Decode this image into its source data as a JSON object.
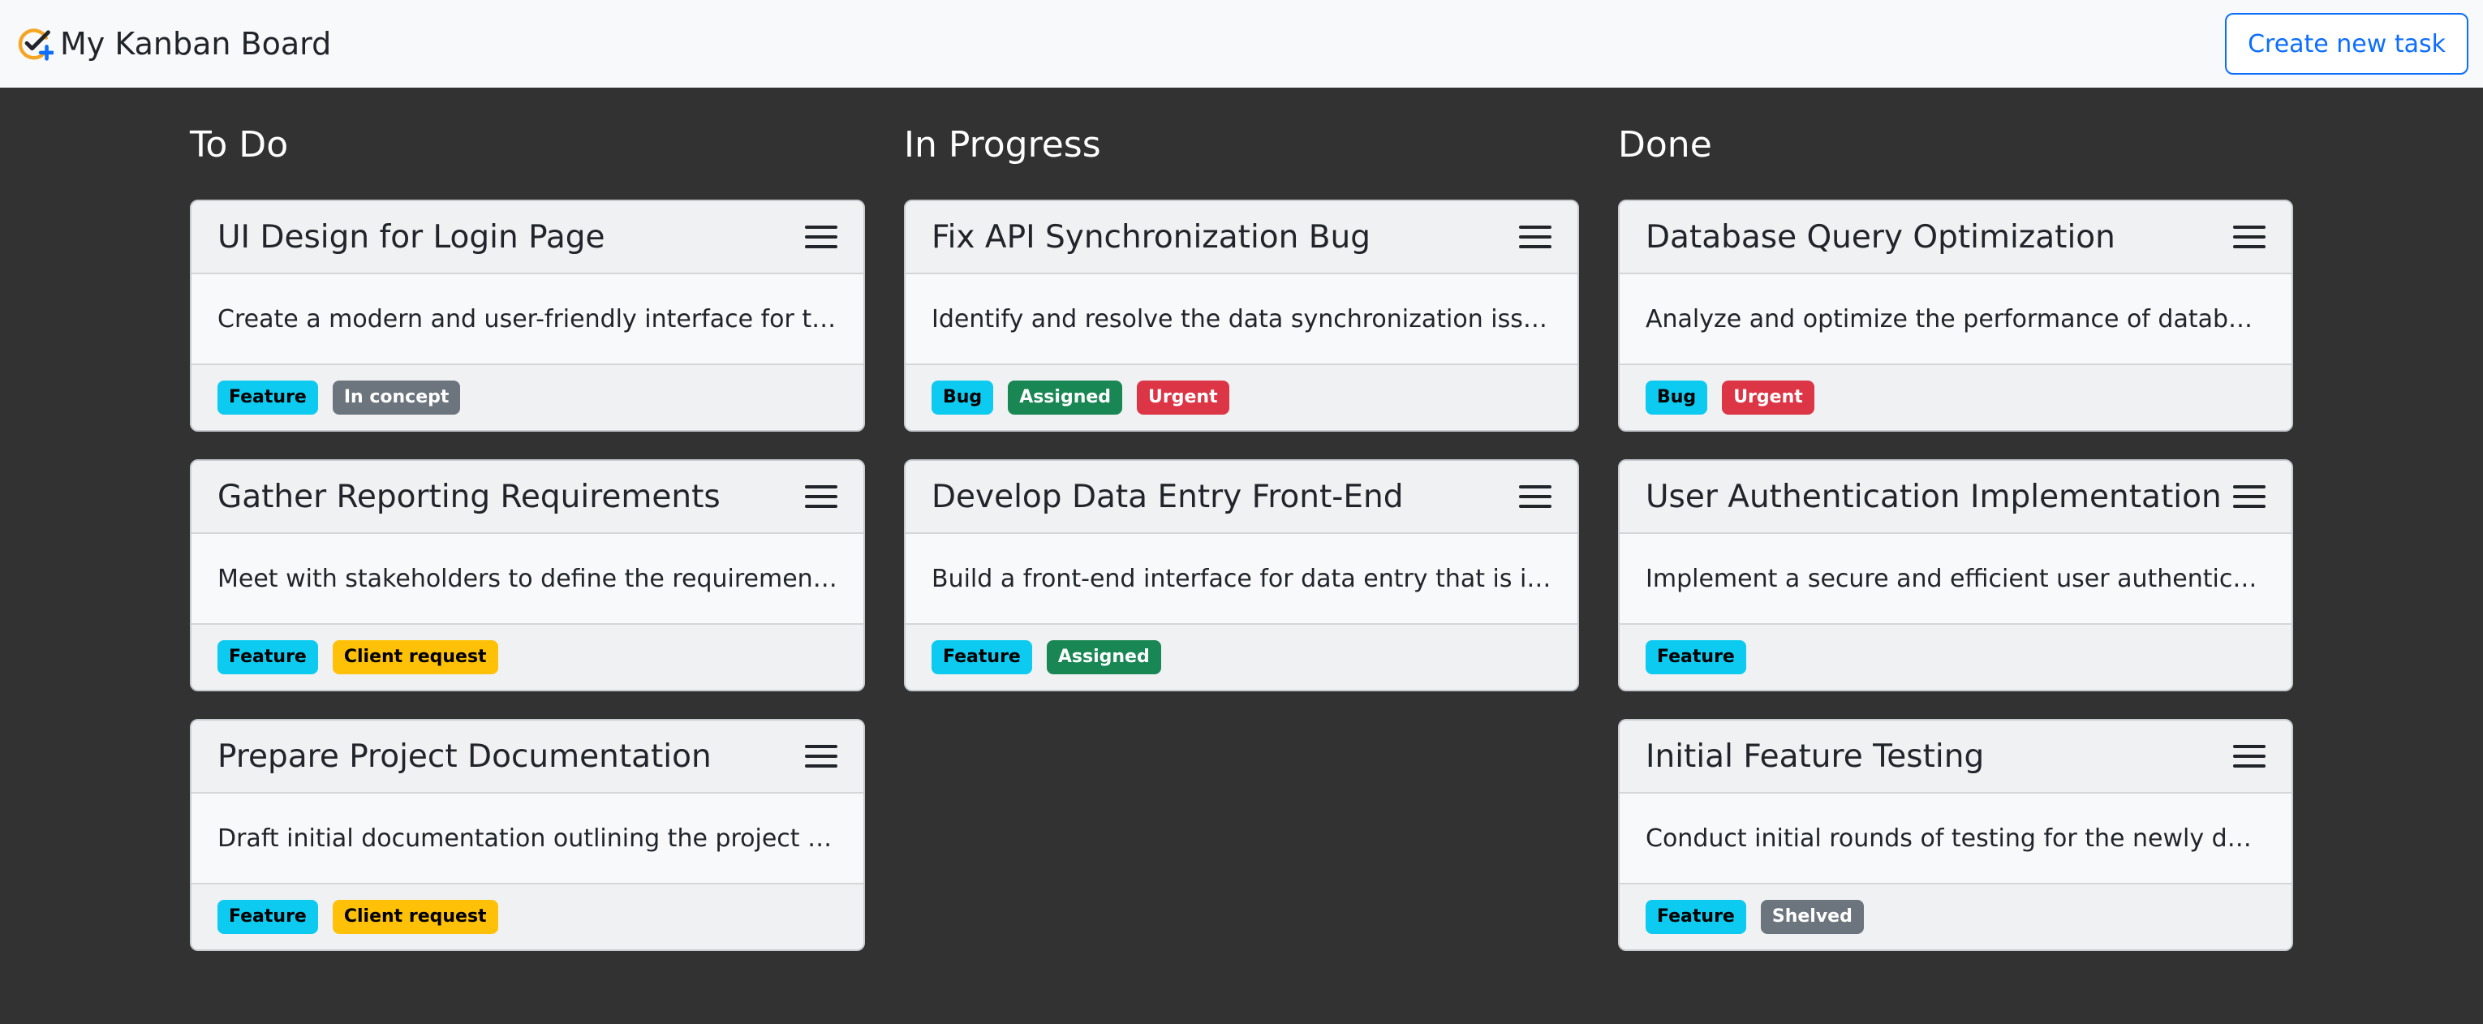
{
  "app": {
    "title": "My Kanban Board",
    "create_label": "Create new task",
    "logo_icon": "check-plus-icon",
    "colors": {
      "accent": "#0d6efd",
      "background": "#323232"
    }
  },
  "columns": [
    {
      "title": "To Do",
      "cards": [
        {
          "title": "UI Design for Login Page",
          "description": "Create a modern and user-friendly interface for the login page",
          "tags": [
            {
              "label": "Feature",
              "variant": "info"
            },
            {
              "label": "In concept",
              "variant": "secondary"
            }
          ]
        },
        {
          "title": "Gather Reporting Requirements",
          "description": "Meet with stakeholders to define the requirements for reporting",
          "tags": [
            {
              "label": "Feature",
              "variant": "info"
            },
            {
              "label": "Client request",
              "variant": "warning"
            }
          ]
        },
        {
          "title": "Prepare Project Documentation",
          "description": "Draft initial documentation outlining the project scope",
          "tags": [
            {
              "label": "Feature",
              "variant": "info"
            },
            {
              "label": "Client request",
              "variant": "warning"
            }
          ]
        }
      ]
    },
    {
      "title": "In Progress",
      "cards": [
        {
          "title": "Fix API Synchronization Bug",
          "description": "Identify and resolve the data synchronization issue",
          "tags": [
            {
              "label": "Bug",
              "variant": "info"
            },
            {
              "label": "Assigned",
              "variant": "success"
            },
            {
              "label": "Urgent",
              "variant": "danger"
            }
          ]
        },
        {
          "title": "Develop Data Entry Front-End",
          "description": "Build a front-end interface for data entry that is intuitive",
          "tags": [
            {
              "label": "Feature",
              "variant": "info"
            },
            {
              "label": "Assigned",
              "variant": "success"
            }
          ]
        }
      ]
    },
    {
      "title": "Done",
      "cards": [
        {
          "title": "Database Query Optimization",
          "description": "Analyze and optimize the performance of database queries",
          "tags": [
            {
              "label": "Bug",
              "variant": "info"
            },
            {
              "label": "Urgent",
              "variant": "danger"
            }
          ]
        },
        {
          "title": "User Authentication Implementation",
          "description": "Implement a secure and efficient user authentication system",
          "tags": [
            {
              "label": "Feature",
              "variant": "info"
            }
          ]
        },
        {
          "title": "Initial Feature Testing",
          "description": "Conduct initial rounds of testing for the newly developed features",
          "tags": [
            {
              "label": "Feature",
              "variant": "info"
            },
            {
              "label": "Shelved",
              "variant": "secondary"
            }
          ]
        }
      ]
    }
  ]
}
